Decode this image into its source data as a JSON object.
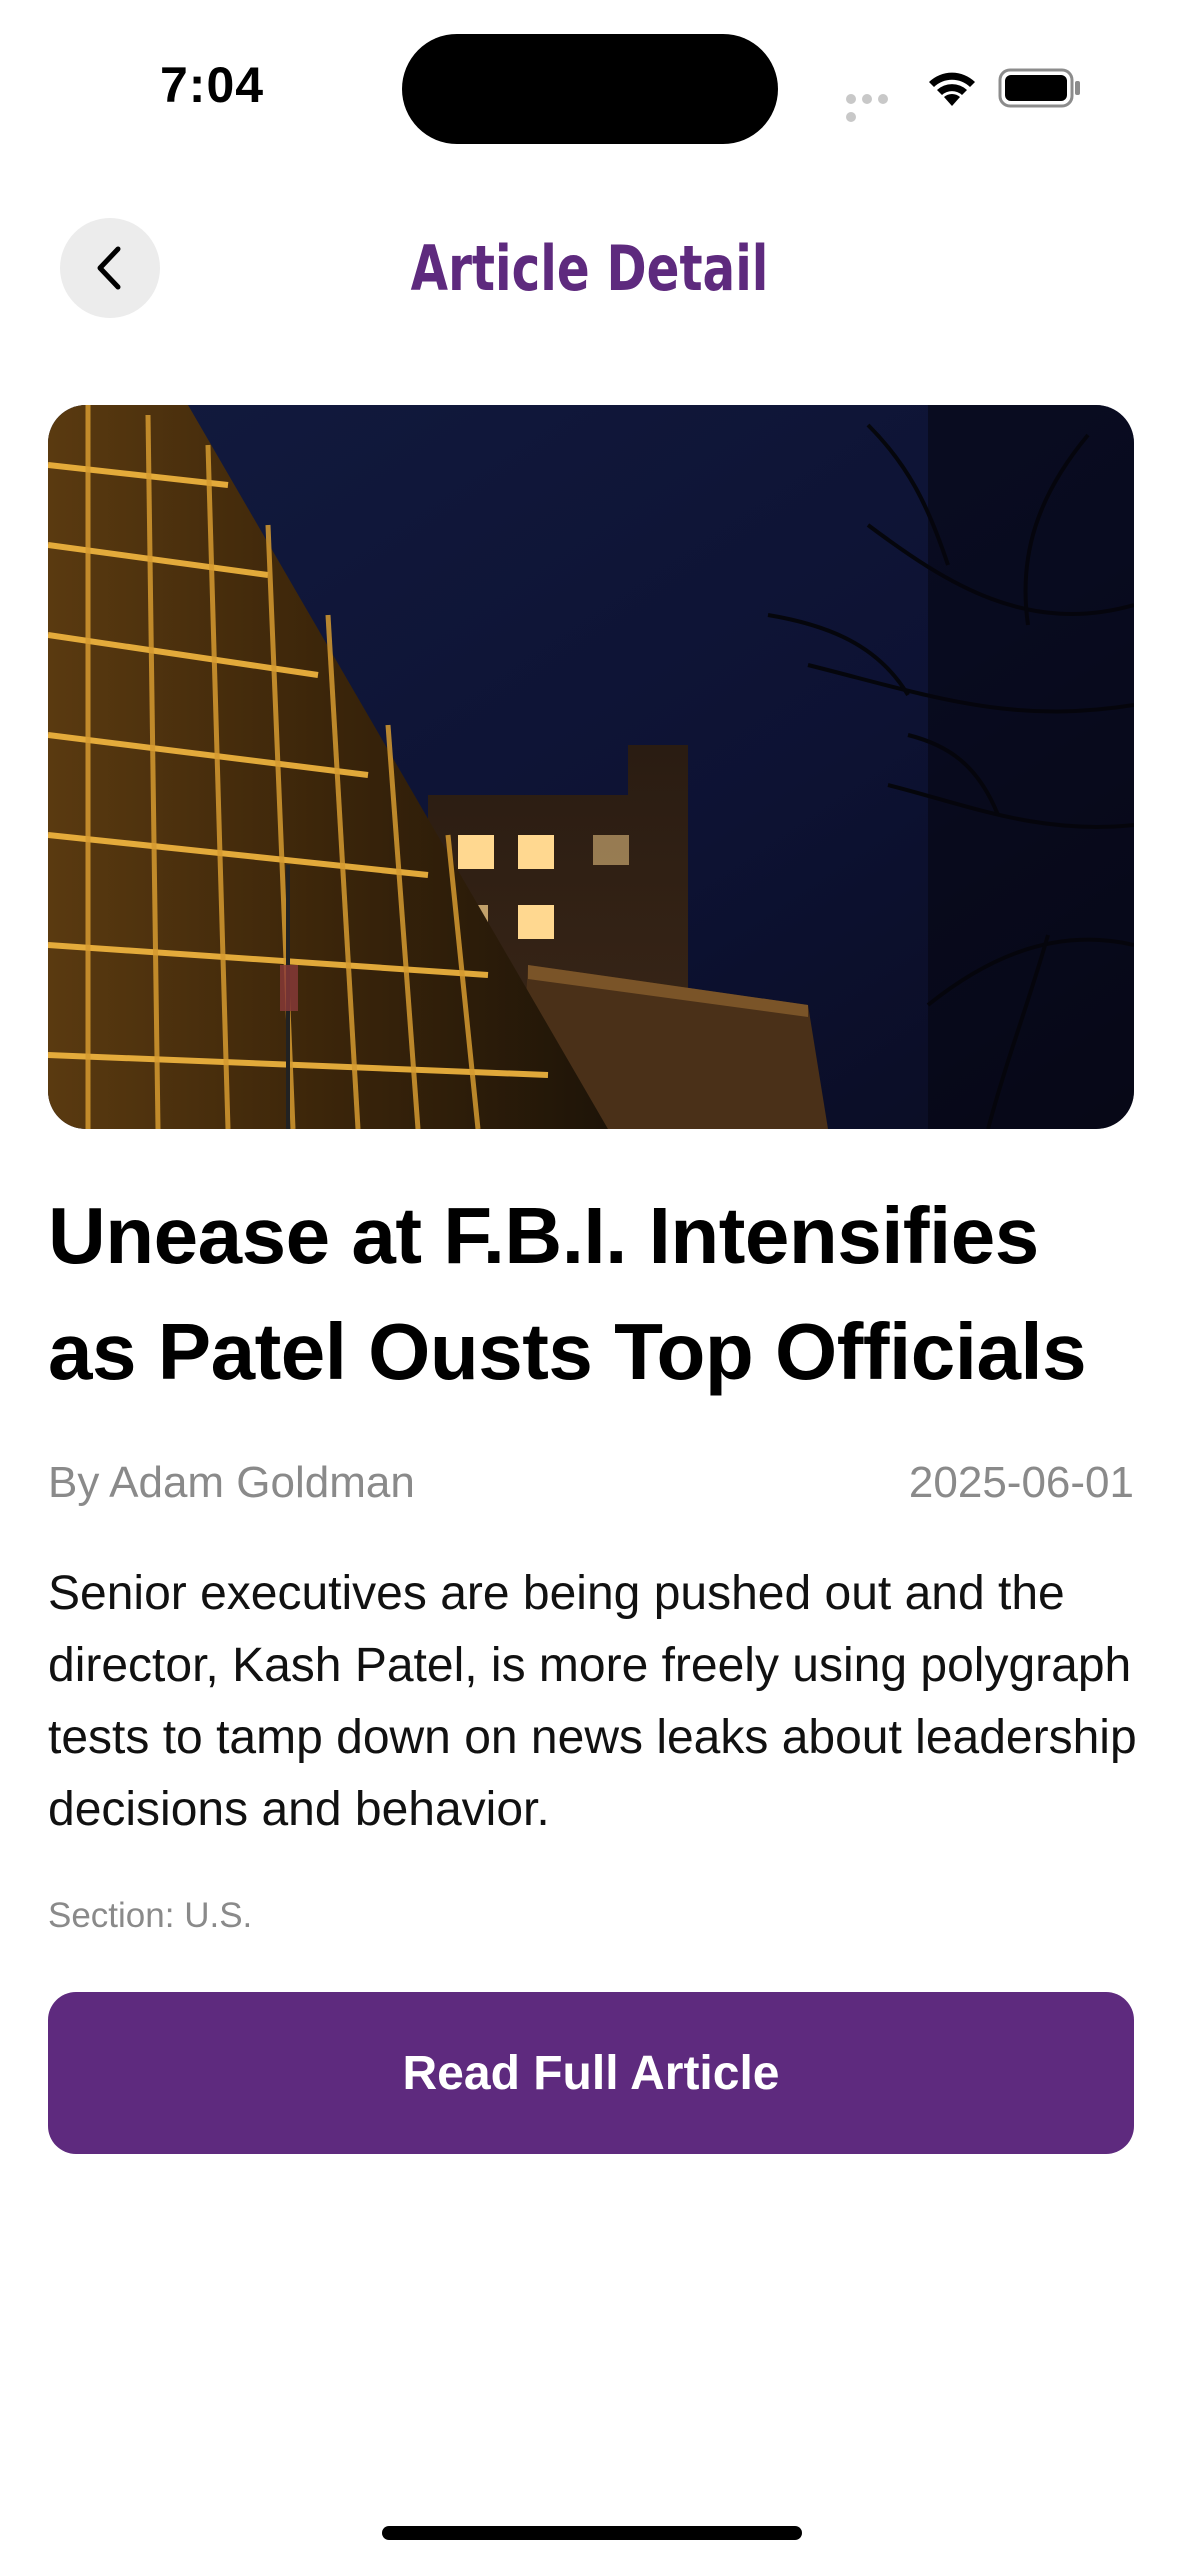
{
  "status_bar": {
    "time": "7:04"
  },
  "header": {
    "title": "Article Detail",
    "back_icon": "chevron-left-icon"
  },
  "article": {
    "headline": "Unease at F.B.I. Intensifies as Patel Ousts Top Officials",
    "byline": "By Adam Goldman",
    "date": "2025-06-01",
    "summary": "Senior executives are being pushed out and the director, Kash Patel, is more freely using polygraph tests to tamp down on news leaks about leadership decisions and behavior.",
    "section": "Section: U.S."
  },
  "actions": {
    "read_full_label": "Read Full Article"
  },
  "colors": {
    "accent": "#5e2a7e",
    "muted_text": "#8a8a8a",
    "back_button_bg": "#ececec"
  }
}
